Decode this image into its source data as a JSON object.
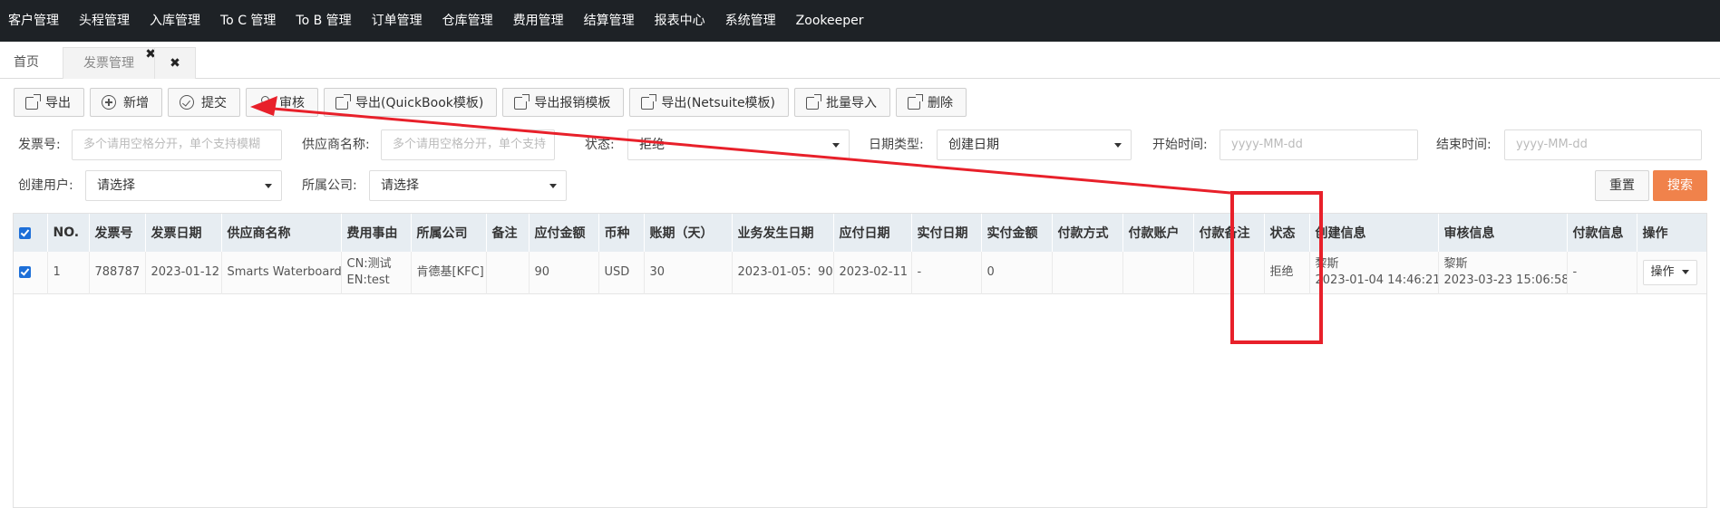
{
  "topnav": {
    "items": [
      "客户管理",
      "头程管理",
      "入库管理",
      "To C 管理",
      "To B 管理",
      "订单管理",
      "仓库管理",
      "费用管理",
      "结算管理",
      "报表中心",
      "系统管理",
      "Zookeeper"
    ]
  },
  "tabs": {
    "home": "首页",
    "invoice": "发票管理",
    "invoice_close": "✖",
    "close_all": "✖"
  },
  "toolbar": {
    "export": "导出",
    "add": "新增",
    "submit": "提交",
    "audit": "审核",
    "export_quickbook": "导出(QuickBook模板)",
    "export_reimburse": "导出报销模板",
    "export_netsuite": "导出(Netsuite模板)",
    "batch_import": "批量导入",
    "delete": "删除"
  },
  "filters": {
    "invoice_no_label": "发票号:",
    "invoice_no_placeholder": "多个请用空格分开，单个支持模糊",
    "supplier_label": "供应商名称:",
    "supplier_placeholder": "多个请用空格分开，单个支持",
    "status_label": "状态:",
    "status_value": "拒绝",
    "date_type_label": "日期类型:",
    "date_type_value": "创建日期",
    "start_time_label": "开始时间:",
    "start_time_placeholder": "yyyy-MM-dd",
    "end_time_label": "结束时间:",
    "end_time_placeholder": "yyyy-MM-dd",
    "creator_label": "创建用户:",
    "creator_value": "请选择",
    "company_label": "所属公司:",
    "company_value": "请选择",
    "reset": "重置",
    "search": "搜索"
  },
  "table": {
    "headers": [
      "NO.",
      "发票号",
      "发票日期",
      "供应商名称",
      "费用事由",
      "所属公司",
      "备注",
      "应付金额",
      "币种",
      "账期（天）",
      "业务发生日期",
      "应付日期",
      "实付日期",
      "实付金额",
      "付款方式",
      "付款账户",
      "付款备注",
      "状态",
      "创建信息",
      "审核信息",
      "付款信息",
      "操作"
    ],
    "rows": [
      {
        "no": "1",
        "invoice_no": "788787",
        "invoice_date": "2023-01-12",
        "supplier": "Smarts Waterboard",
        "reason_cn": "CN:测试",
        "reason_en": "EN:test",
        "company": "肯德基[KFC]",
        "remark": "",
        "payable": "90",
        "currency": "USD",
        "term": "30",
        "biz_date": "2023-01-05：90",
        "due_date": "2023-02-11",
        "paid_date": "-",
        "paid_amount": "0",
        "pay_method": "",
        "pay_account": "",
        "pay_remark": "",
        "status": "拒绝",
        "creator_name": "黎斯",
        "creator_time": "2023-01-04 14:46:21",
        "auditor_name": "黎斯",
        "audit_time": "2023-03-23 15:06:58",
        "pay_info": "-",
        "action": "操作"
      }
    ]
  },
  "annotation": {
    "color": "#e8202a"
  }
}
